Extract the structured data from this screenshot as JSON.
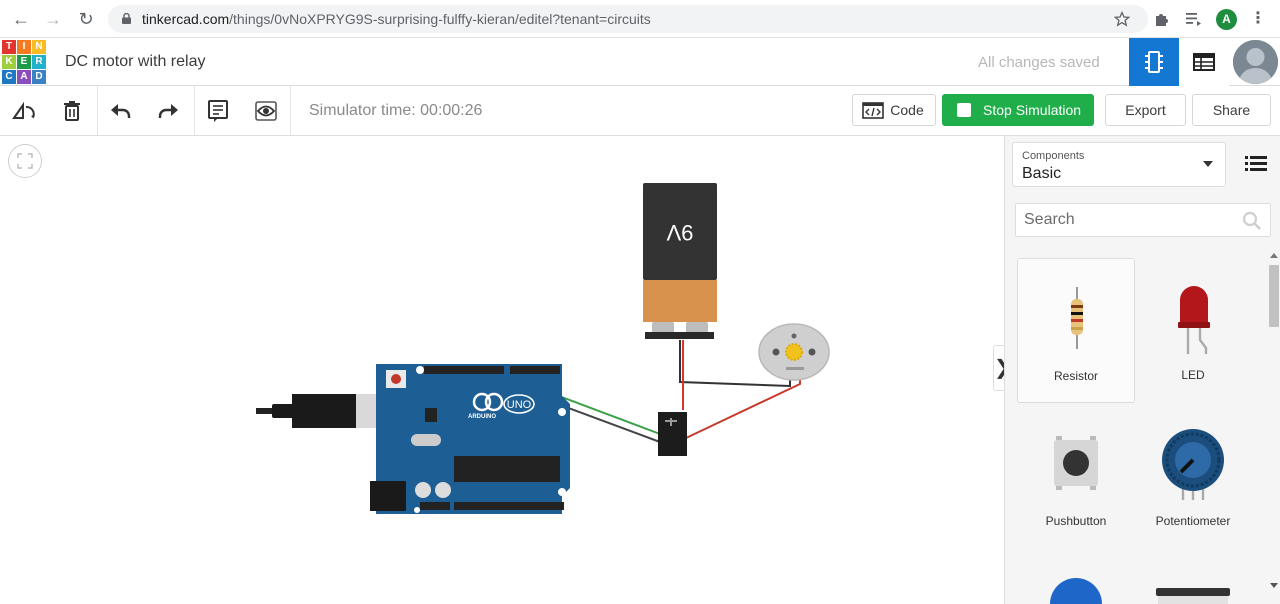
{
  "browser": {
    "url_domain": "tinkercad.com",
    "url_path": "/things/0vNoXPRYG9S-surprising-fulffy-kieran/editel?tenant=circuits",
    "profile_initial": "A"
  },
  "header": {
    "logo_letters": [
      "T",
      "I",
      "N",
      "K",
      "E",
      "R",
      "C",
      "A",
      "D"
    ],
    "logo_colors": [
      "#e2352f",
      "#f47b20",
      "#f6bd27",
      "#9fce3f",
      "#1f9b4b",
      "#20b1cf",
      "#1e78c2",
      "#8a4fbf",
      "#3b82c4"
    ],
    "title": "DC motor with relay",
    "save_status": "All changes saved"
  },
  "toolbar": {
    "simulator_time": "Simulator time: 00:00:26",
    "code_label": "Code",
    "stop_label": "Stop Simulation",
    "export_label": "Export",
    "share_label": "Share"
  },
  "canvas": {
    "battery_label": "9V",
    "arduino_brand": "ARDUINO",
    "arduino_model": "UNO",
    "expand_tab": "❯"
  },
  "panel": {
    "components_label": "Components",
    "components_value": "Basic",
    "search_placeholder": "Search",
    "items": [
      {
        "name": "Resistor"
      },
      {
        "name": "LED"
      },
      {
        "name": "Pushbutton"
      },
      {
        "name": "Potentiometer"
      }
    ]
  },
  "colors": {
    "accent_blue": "#1477d1",
    "stop_green": "#1fae4a",
    "arduino_blue": "#1d5e94"
  }
}
